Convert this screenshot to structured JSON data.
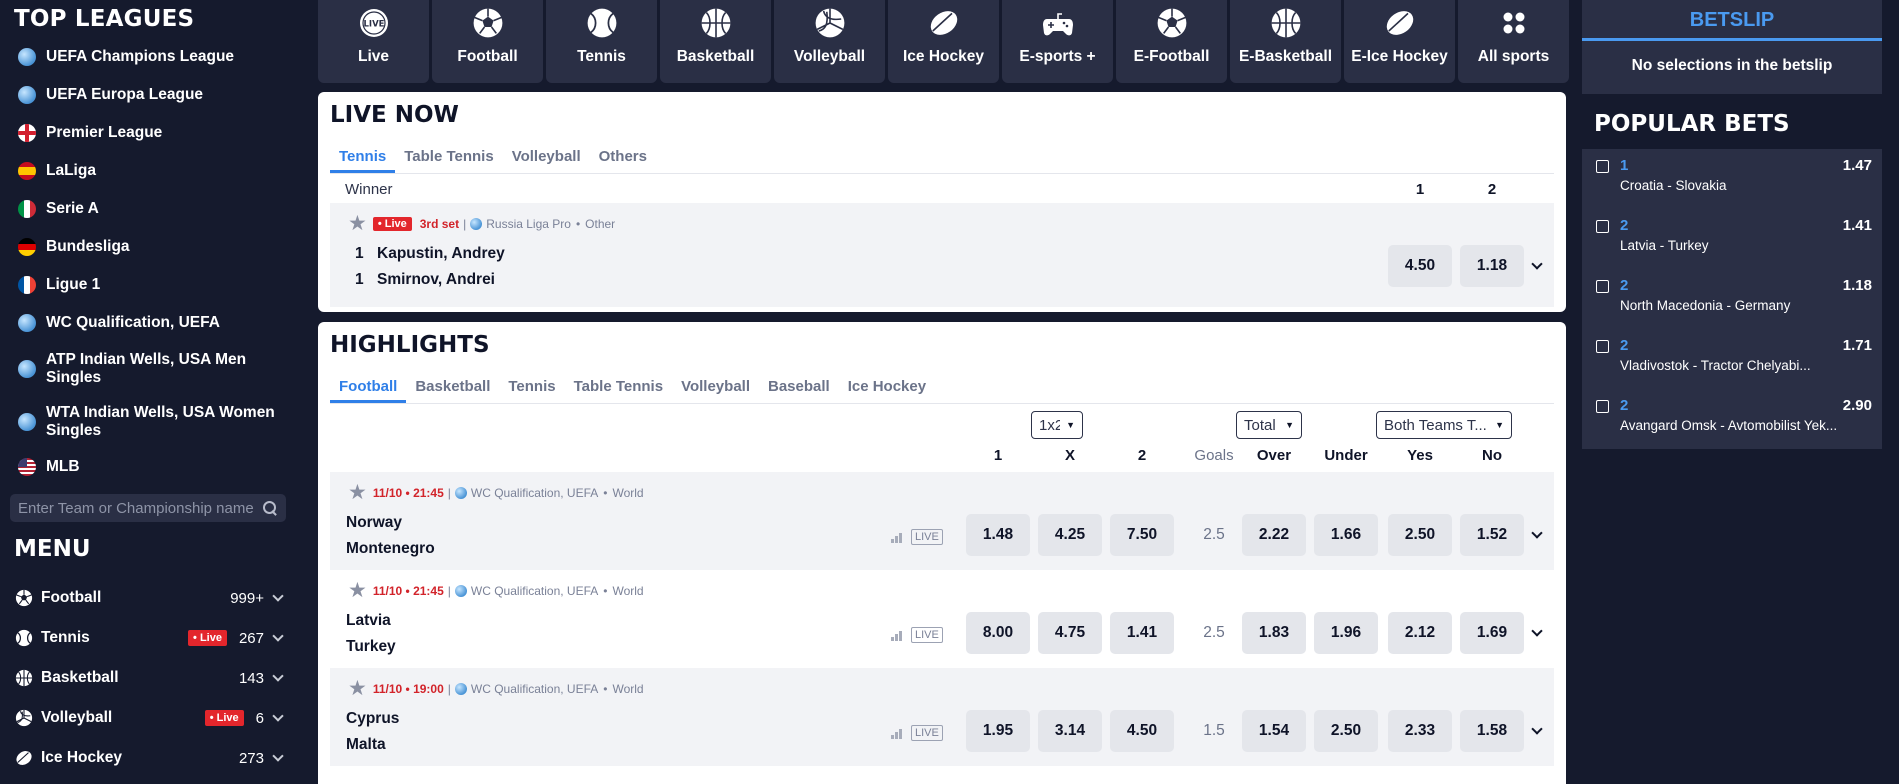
{
  "sidebar": {
    "top_leagues_title": "TOP LEAGUES",
    "leagues": [
      {
        "label": "UEFA Champions League",
        "icon": "globe-icon"
      },
      {
        "label": "UEFA Europa League",
        "icon": "globe-icon"
      },
      {
        "label": "Premier League",
        "icon": "england-flag-icon"
      },
      {
        "label": "LaLiga",
        "icon": "spain-flag-icon"
      },
      {
        "label": "Serie A",
        "icon": "italy-flag-icon"
      },
      {
        "label": "Bundesliga",
        "icon": "germany-flag-icon"
      },
      {
        "label": "Ligue 1",
        "icon": "france-flag-icon"
      },
      {
        "label": "WC Qualification, UEFA",
        "icon": "globe-icon"
      },
      {
        "label": "ATP Indian Wells, USA Men Singles",
        "icon": "globe-icon"
      },
      {
        "label": "WTA Indian Wells, USA Women Singles",
        "icon": "globe-icon"
      },
      {
        "label": "MLB",
        "icon": "usa-flag-icon"
      }
    ],
    "search_placeholder": "Enter Team or Championship name",
    "menu_title": "MENU",
    "menu": [
      {
        "label": "Football",
        "count": "999+",
        "live": ""
      },
      {
        "label": "Tennis",
        "count": "267",
        "live": "• Live"
      },
      {
        "label": "Basketball",
        "count": "143",
        "live": ""
      },
      {
        "label": "Volleyball",
        "count": "6",
        "live": "• Live"
      },
      {
        "label": "Ice Hockey",
        "count": "273",
        "live": ""
      }
    ]
  },
  "sports_bar": [
    {
      "label": "Live",
      "icon": "live-icon"
    },
    {
      "label": "Football",
      "icon": "football-icon"
    },
    {
      "label": "Tennis",
      "icon": "tennis-ball-icon"
    },
    {
      "label": "Basketball",
      "icon": "basketball-icon"
    },
    {
      "label": "Volleyball",
      "icon": "volleyball-icon"
    },
    {
      "label": "Ice Hockey",
      "icon": "hockey-puck-icon"
    },
    {
      "label": "E-sports +",
      "icon": "gamepad-icon"
    },
    {
      "label": "E-Football",
      "icon": "football-icon"
    },
    {
      "label": "E-Basketball",
      "icon": "basketball-icon"
    },
    {
      "label": "E-Ice Hockey",
      "icon": "hockey-puck-icon"
    },
    {
      "label": "All sports",
      "icon": "grid-icon"
    }
  ],
  "live_now": {
    "title": "LIVE NOW",
    "tabs": [
      "Tennis",
      "Table Tennis",
      "Volleyball",
      "Others"
    ],
    "active_tab": "Tennis",
    "market_label": "Winner",
    "col1": "1",
    "col2": "2",
    "event": {
      "live": "• Live",
      "status": "3rd set",
      "sep": "|",
      "league": "Russia Liga Pro",
      "region": "Other",
      "team1_score": "1",
      "team1": "Kapustin, Andrey",
      "team2_score": "1",
      "team2": "Smirnov, Andrei",
      "odd1": "4.50",
      "odd2": "1.18"
    }
  },
  "highlights": {
    "title": "HIGHLIGHTS",
    "tabs": [
      "Football",
      "Basketball",
      "Tennis",
      "Table Tennis",
      "Volleyball",
      "Baseball",
      "Ice Hockey"
    ],
    "active_tab": "Football",
    "selects": {
      "market1": "1x2",
      "market2": "Total",
      "market3": "Both Teams T..."
    },
    "headers": {
      "h1": "1",
      "hx": "X",
      "h2": "2",
      "goals": "Goals",
      "over": "Over",
      "under": "Under",
      "yes": "Yes",
      "no": "No"
    },
    "live_label": "LIVE",
    "events": [
      {
        "time": "11/10 • 21:45",
        "league": "WC Qualification, UEFA",
        "region": "World",
        "team1": "Norway",
        "team2": "Montenegro",
        "o1": "1.48",
        "ox": "4.25",
        "o2": "7.50",
        "goals": "2.5",
        "over": "2.22",
        "under": "1.66",
        "yes": "2.50",
        "no": "1.52"
      },
      {
        "time": "11/10 • 21:45",
        "league": "WC Qualification, UEFA",
        "region": "World",
        "team1": "Latvia",
        "team2": "Turkey",
        "o1": "8.00",
        "ox": "4.75",
        "o2": "1.41",
        "goals": "2.5",
        "over": "1.83",
        "under": "1.96",
        "yes": "2.12",
        "no": "1.69"
      },
      {
        "time": "11/10 • 19:00",
        "league": "WC Qualification, UEFA",
        "region": "World",
        "team1": "Cyprus",
        "team2": "Malta",
        "o1": "1.95",
        "ox": "3.14",
        "o2": "4.50",
        "goals": "1.5",
        "over": "1.54",
        "under": "2.50",
        "yes": "2.33",
        "no": "1.58"
      }
    ]
  },
  "betslip": {
    "title": "BETSLIP",
    "empty_text": "No selections in the betslip"
  },
  "popular_bets": {
    "title": "POPULAR BETS",
    "items": [
      {
        "selection": "1",
        "odds": "1.47",
        "match": "Croatia - Slovakia"
      },
      {
        "selection": "2",
        "odds": "1.41",
        "match": "Latvia - Turkey"
      },
      {
        "selection": "2",
        "odds": "1.18",
        "match": "North Macedonia - Germany"
      },
      {
        "selection": "2",
        "odds": "1.71",
        "match": "Vladivostok - Tractor Chelyabi..."
      },
      {
        "selection": "2",
        "odds": "2.90",
        "match": "Avangard Omsk - Avtomobilist Yek..."
      }
    ]
  },
  "colors": {
    "background": "#151a2d",
    "tile": "#2a2f45",
    "accent": "#2f7fe8",
    "live_red": "#e3262c"
  }
}
